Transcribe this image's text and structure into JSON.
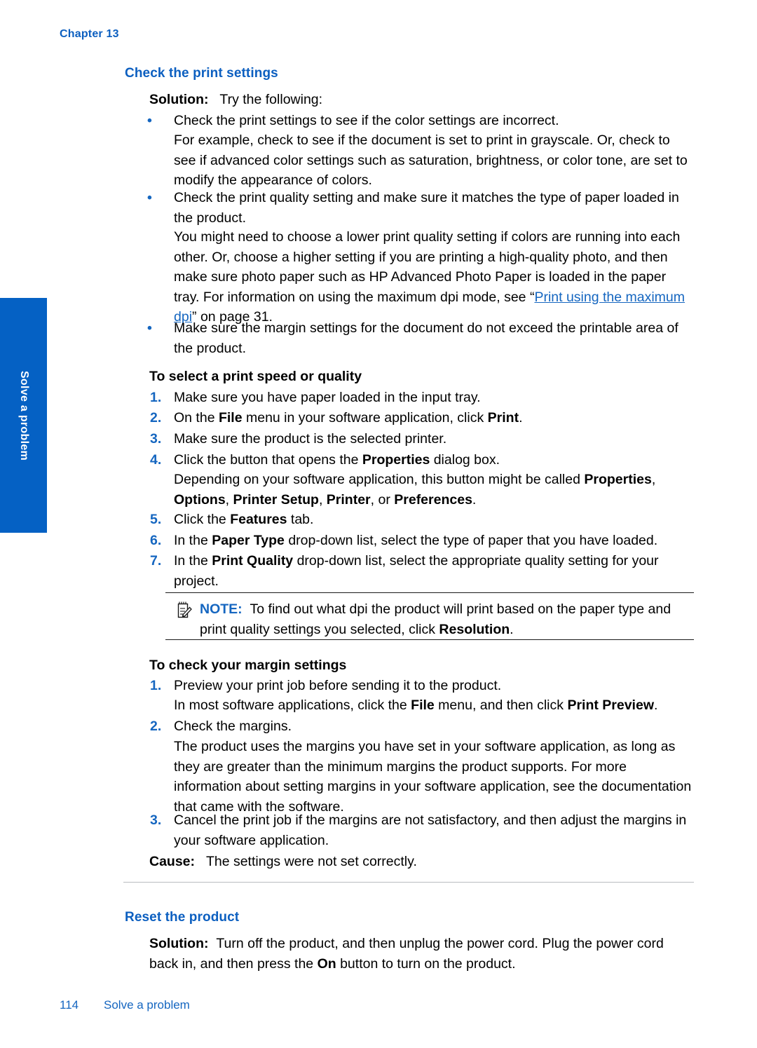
{
  "page": {
    "chapter": "Chapter 13",
    "side_tab_label": "Solve a problem",
    "footer_page_number": "114",
    "footer_section": "Solve a problem",
    "accent_blue": "#0c5fc0",
    "tab_blue": "#0561c4",
    "link_blue": "#1566c0"
  },
  "section1": {
    "heading": "Check the print settings",
    "solution_label": "Solution:",
    "solution_intro": "Try the following:",
    "bullets": [
      {
        "marker": "•",
        "line1": "Check the print settings to see if the color settings are incorrect.",
        "para": "For example, check to see if the document is set to print in grayscale. Or, check to see if advanced color settings such as saturation, brightness, or color tone, are set to modify the appearance of colors."
      },
      {
        "marker": "•",
        "line1": "Check the print quality setting and make sure it matches the type of paper loaded in the product.",
        "para_a": "You might need to choose a lower print quality setting if colors are running into each other. Or, choose a higher setting if you are printing a high-quality photo, and then make sure photo paper such as HP Advanced Photo Paper is loaded in the paper tray. For information on using the maximum dpi mode, see “",
        "link": "Print using the maximum dpi",
        "para_b": "” on page 31."
      },
      {
        "marker": "•",
        "line1": "Make sure the margin settings for the document do not exceed the printable area of the product."
      }
    ],
    "proc1": {
      "heading": "To select a print speed or quality",
      "steps": [
        {
          "num": "1.",
          "text": "Make sure you have paper loaded in the input tray."
        },
        {
          "num": "2.",
          "pre": "On the ",
          "b1": "File",
          "mid": " menu in your software application, click ",
          "b2": "Print",
          "post": "."
        },
        {
          "num": "3.",
          "text": "Make sure the product is the selected printer."
        },
        {
          "num": "4.",
          "pre": "Click the button that opens the ",
          "b1": "Properties",
          "post": " dialog box.",
          "sub_pre": "Depending on your software application, this button might be called ",
          "sub_b1": "Properties",
          "sub_c1": ", ",
          "sub_b2": "Options",
          "sub_c2": ", ",
          "sub_b3": "Printer Setup",
          "sub_c3": ", ",
          "sub_b4": "Printer",
          "sub_c4": ", or ",
          "sub_b5": "Preferences",
          "sub_c5": "."
        },
        {
          "num": "5.",
          "pre": "Click the ",
          "b1": "Features",
          "post": " tab."
        },
        {
          "num": "6.",
          "pre": "In the ",
          "b1": "Paper Type",
          "post": " drop-down list, select the type of paper that you have loaded."
        },
        {
          "num": "7.",
          "pre": "In the ",
          "b1": "Print Quality",
          "post": " drop-down list, select the appropriate quality setting for your project."
        }
      ]
    },
    "note": {
      "icon": "note-pencil-icon",
      "label": "NOTE:",
      "text_a": "To find out what dpi the product will print based on the paper type and print quality settings you selected, click ",
      "bold": "Resolution",
      "text_b": "."
    },
    "proc2": {
      "heading": "To check your margin settings",
      "steps": [
        {
          "num": "1.",
          "text": "Preview your print job before sending it to the product.",
          "sub_pre": "In most software applications, click the ",
          "sub_b1": "File",
          "sub_mid": " menu, and then click ",
          "sub_b2": "Print Preview",
          "sub_post": "."
        },
        {
          "num": "2.",
          "text": "Check the margins.",
          "sub": "The product uses the margins you have set in your software application, as long as they are greater than the minimum margins the product supports. For more information about setting margins in your software application, see the documentation that came with the software."
        },
        {
          "num": "3.",
          "text": "Cancel the print job if the margins are not satisfactory, and then adjust the margins in your software application."
        }
      ]
    },
    "cause_label": "Cause:",
    "cause_text": "The settings were not set correctly."
  },
  "section2": {
    "heading": "Reset the product",
    "solution_label": "Solution:",
    "solution_pre": "Turn off the product, and then unplug the power cord. Plug the power cord back in, and then press the ",
    "solution_bold": "On",
    "solution_post": " button to turn on the product."
  }
}
